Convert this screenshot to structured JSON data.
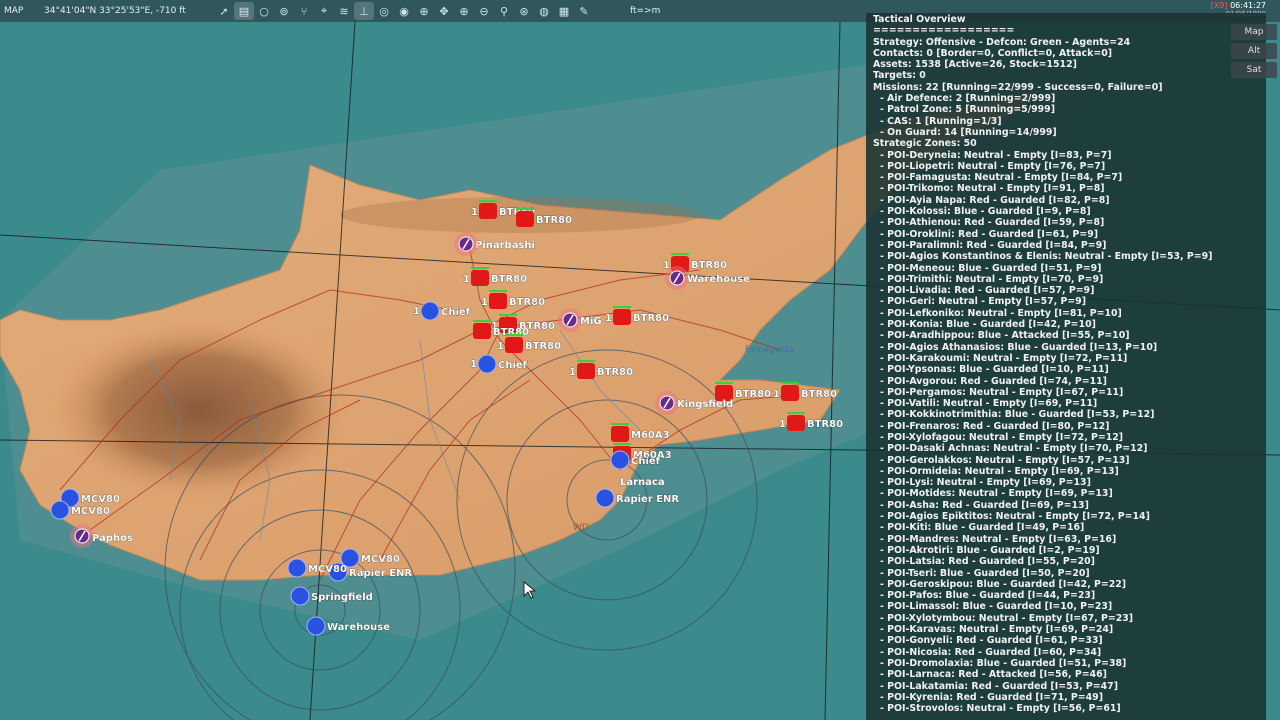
{
  "topbar": {
    "mode_label": "MAP",
    "coords": "34°41'04\"N 33°25'53\"E, -710 ft",
    "units_toggle": "ft=>m",
    "tools": [
      "pointer-icon",
      "layers-icon",
      "circle-icon",
      "group-icon",
      "branch-icon",
      "target-icon",
      "wifi-icon",
      "ruler-icon",
      "route-icon",
      "eye-icon",
      "add-icon",
      "move-icon",
      "zoom-in-icon",
      "zoom-out-icon",
      "zoom-icon",
      "filter-icon",
      "globe-icon",
      "grid-icon",
      "pencil-icon"
    ]
  },
  "clock": {
    "tag": "[X9]",
    "time": "06:41:27",
    "date": "01/06/1990"
  },
  "map_types": [
    "Map",
    "Alt",
    "Sat"
  ],
  "panel": {
    "title": "Tactical Overview",
    "separator": "==================",
    "strategy": "Strategy: Offensive - Defcon: Green - Agents=24",
    "contacts": "Contacts: 0 [Border=0, Conflict=0, Attack=0]",
    "assets": "Assets: 1538 [Active=26, Stock=1512]",
    "targets": "Targets: 0",
    "missions": "Missions: 22 [Running=22/999 - Success=0, Failure=0]",
    "mission_items": [
      "- Air Defence: 2 [Running=2/999]",
      "- Patrol Zone: 5 [Running=5/999]",
      "- CAS: 1 [Running=1/3]",
      "- On Guard: 14 [Running=14/999]"
    ],
    "zones_header": "Strategic Zones: 50",
    "pois": [
      "- POI-Deryneia: Neutral - Empty [I=83, P=7]",
      "- POI-Liopetri: Neutral - Empty [I=76, P=7]",
      "- POI-Famagusta: Neutral - Empty [I=84, P=7]",
      "- POI-Trikomo: Neutral - Empty [I=91, P=8]",
      "- POI-Ayia Napa: Red - Guarded [I=82, P=8]",
      "- POI-Kolossi: Blue - Guarded [I=9, P=8]",
      "- POI-Athienou: Red - Guarded [I=59, P=8]",
      "- POI-Oroklini: Red - Guarded [I=61, P=9]",
      "- POI-Paralimni: Red - Guarded [I=84, P=9]",
      "- POI-Agios Konstantinos & Elenis: Neutral - Empty [I=53, P=9]",
      "- POI-Meneou: Blue - Guarded [I=51, P=9]",
      "- POI-Trimithi: Neutral - Empty [I=70, P=9]",
      "- POI-Livadia: Red - Guarded [I=57, P=9]",
      "- POI-Geri: Neutral - Empty [I=57, P=9]",
      "- POI-Lefkoniko: Neutral - Empty [I=81, P=10]",
      "- POI-Konia: Blue - Guarded [I=42, P=10]",
      "- POI-Aradhippou: Blue - Attacked [I=55, P=10]",
      "- POI-Agios Athanasios: Blue - Guarded [I=13, P=10]",
      "- POI-Karakoumi: Neutral - Empty [I=72, P=11]",
      "- POI-Ypsonas: Blue - Guarded [I=10, P=11]",
      "- POI-Avgorou: Red - Guarded [I=74, P=11]",
      "- POI-Pergamos: Neutral - Empty [I=67, P=11]",
      "- POI-Vatili: Neutral - Empty [I=69, P=11]",
      "- POI-Kokkinotrimithia: Blue - Guarded [I=53, P=12]",
      "- POI-Frenaros: Red - Guarded [I=80, P=12]",
      "- POI-Xylofagou: Neutral - Empty [I=72, P=12]",
      "- POI-Dasaki Achnas: Neutral - Empty [I=70, P=12]",
      "- POI-Gerolakkos: Neutral - Empty [I=57, P=13]",
      "- POI-Ormideia: Neutral - Empty [I=69, P=13]",
      "- POI-Lysi: Neutral - Empty [I=69, P=13]",
      "- POI-Motides: Neutral - Empty [I=69, P=13]",
      "- POI-Asha: Red - Guarded [I=69, P=13]",
      "- POI-Agios Epiktitos: Neutral - Empty [I=72, P=14]",
      "- POI-Kiti: Blue - Guarded [I=49, P=16]",
      "- POI-Mandres: Neutral - Empty [I=63, P=16]",
      "- POI-Akrotiri: Blue - Guarded [I=2, P=19]",
      "- POI-Latsia: Red - Guarded [I=55, P=20]",
      "- POI-Tseri: Blue - Guarded [I=50, P=20]",
      "- POI-Geroskipou: Blue - Guarded [I=42, P=22]",
      "- POI-Pafos: Blue - Guarded [I=44, P=23]",
      "- POI-Limassol: Blue - Guarded [I=10, P=23]",
      "- POI-Xylotymbou: Neutral - Empty [I=67, P=23]",
      "- POI-Karavas: Neutral - Empty [I=69, P=24]",
      "- POI-Gonyeli: Red - Guarded [I=61, P=33]",
      "- POI-Nicosia: Red - Guarded [I=60, P=34]",
      "- POI-Dromolaxia: Blue - Guarded [I=51, P=38]",
      "- POI-Larnaca: Red - Attacked [I=56, P=46]",
      "- POI-Lakatamia: Red - Guarded [I=53, P=47]",
      "- POI-Kyrenia: Red - Guarded [I=71, P=49]",
      "- POI-Strovolos: Neutral - Empty [I=56, P=61]"
    ]
  },
  "map": {
    "colors": {
      "sea": "#3b8a8c",
      "land": "#d9a06e",
      "red_force": "#e01818",
      "blue_force": "#2a52e0",
      "road": "#b03020"
    },
    "place_labels": [
      "Pinarbashi",
      "Famagusta",
      "Paphos",
      "Larnaca",
      "WD"
    ],
    "red_units": [
      {
        "label": "BTR80",
        "count": "1"
      },
      {
        "label": "BTR80",
        "count": ""
      },
      {
        "label": "BTR80",
        "count": "1"
      },
      {
        "label": "BTR80",
        "count": "1"
      },
      {
        "label": "BTR80",
        "count": "1"
      },
      {
        "label": "BTR80",
        "count": ""
      },
      {
        "label": "BTR80",
        "count": "1"
      },
      {
        "label": "BTR80",
        "count": "1"
      },
      {
        "label": "BTR80",
        "count": "1"
      },
      {
        "label": "BTR80",
        "count": "1"
      },
      {
        "label": "BTR80",
        "count": ""
      },
      {
        "label": "BTR80",
        "count": "1"
      },
      {
        "label": "M60A3",
        "count": ""
      },
      {
        "label": "M60A3",
        "count": ""
      },
      {
        "label": "BTR80",
        "count": "1"
      }
    ],
    "blue_units": [
      {
        "label": "Chief",
        "count": "1"
      },
      {
        "label": "Chief",
        "count": "1"
      },
      {
        "label": "Chief",
        "count": ""
      },
      {
        "label": "MCV80",
        "count": ""
      },
      {
        "label": "MCV80",
        "count": ""
      },
      {
        "label": "MCV80",
        "count": ""
      },
      {
        "label": "Rapier ENR",
        "count": ""
      },
      {
        "label": "Rapier ENR",
        "count": ""
      },
      {
        "label": "Springfield",
        "count": ""
      },
      {
        "label": "Warehouse",
        "count": ""
      },
      {
        "label": "MCV80",
        "count": ""
      }
    ],
    "air_labels": [
      "Pinarbashi",
      "Kingsfield",
      "Warehouse",
      "MiG",
      "Paphos"
    ]
  }
}
